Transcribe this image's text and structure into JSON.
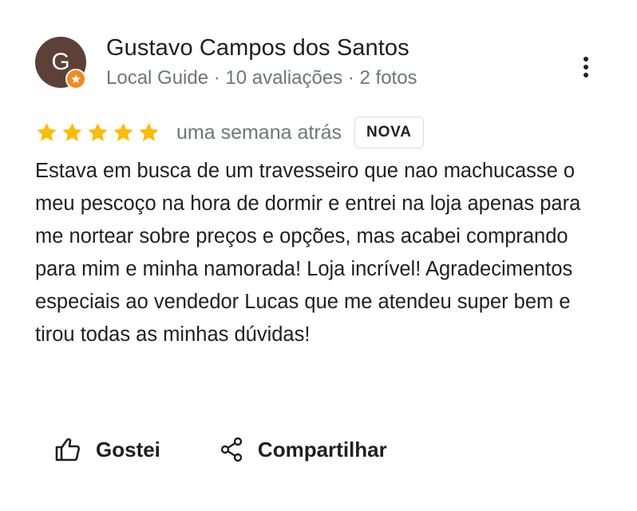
{
  "review": {
    "author": {
      "initial": "G",
      "name": "Gustavo Campos dos Santos",
      "meta": "Local Guide · 10 avaliações · 2 fotos",
      "avatar_color": "#5d4037",
      "badge_color": "#f4891f"
    },
    "rating": {
      "stars": 5,
      "max": 5,
      "star_color": "#fbbc04"
    },
    "date": "uma semana atrás",
    "badge": "NOVA",
    "text": "Estava em busca de um travesseiro que nao machucasse o meu pescoço na hora de dormir e entrei na loja apenas para me nortear sobre preços e opções, mas acabei comprando para mim e minha namorada! Loja incrível! Agradecimentos especiais ao vendedor Lucas que me atendeu super bem e tirou todas as minhas dúvidas!",
    "actions": {
      "like_label": "Gostei",
      "share_label": "Compartilhar"
    },
    "icons": {
      "more": "more-vert-icon",
      "like": "thumb-up-icon",
      "share": "share-icon",
      "guide_badge": "local-guide-star-icon"
    }
  }
}
